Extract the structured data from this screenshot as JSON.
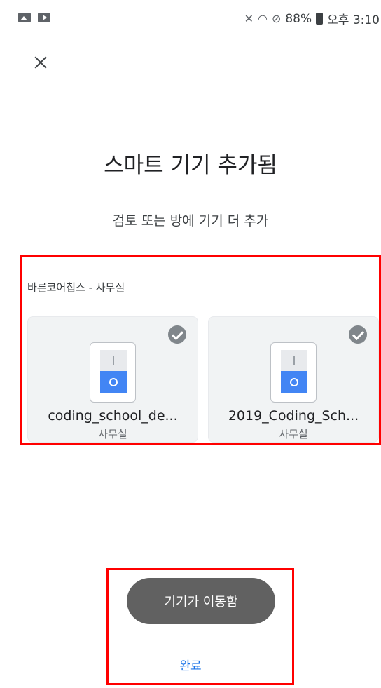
{
  "status_bar": {
    "left_icons": [
      "image-icon",
      "youtube-icon"
    ],
    "right_icons": [
      "mute-icon",
      "wifi-icon",
      "blocked-icon"
    ],
    "battery": "88%",
    "time": "오후 3:10"
  },
  "header": {
    "close_icon": "close-icon"
  },
  "main": {
    "title": "스마트 기기 추가됨",
    "subtitle": "검토 또는 방에 기기 더 추가",
    "room_group": {
      "label": "바른코어칩스 - 사무실",
      "devices": [
        {
          "name": "coding_school_de...",
          "room": "사무실",
          "icon": "light-switch-icon",
          "selected": true
        },
        {
          "name": "2019_Coding_Sch...",
          "room": "사무실",
          "icon": "light-switch-icon",
          "selected": true
        }
      ]
    }
  },
  "toast": {
    "text": "기기가 이동함"
  },
  "footer": {
    "done_label": "완료"
  },
  "colors": {
    "accent": "#1a73e8",
    "switch_on": "#4285f4",
    "highlight_border": "#ff0000",
    "toast_bg": "#616161"
  }
}
